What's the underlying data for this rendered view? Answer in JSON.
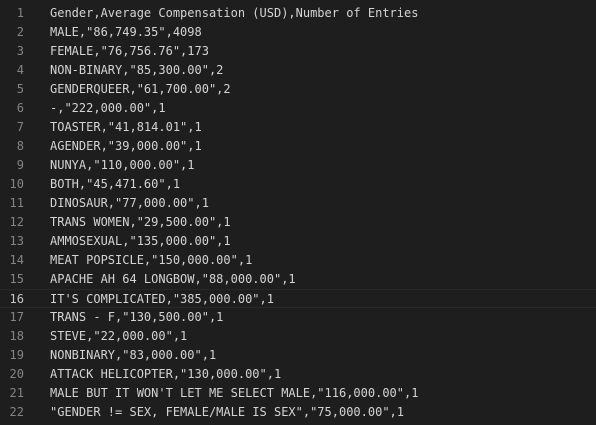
{
  "editor": {
    "current_line": 16,
    "lines": [
      {
        "num": "1",
        "text": "Gender,Average Compensation (USD),Number of Entries"
      },
      {
        "num": "2",
        "text": "MALE,\"86,749.35\",4098"
      },
      {
        "num": "3",
        "text": "FEMALE,\"76,756.76\",173"
      },
      {
        "num": "4",
        "text": "NON-BINARY,\"85,300.00\",2"
      },
      {
        "num": "5",
        "text": "GENDERQUEER,\"61,700.00\",2"
      },
      {
        "num": "6",
        "text": "-,\"222,000.00\",1"
      },
      {
        "num": "7",
        "text": "TOASTER,\"41,814.01\",1"
      },
      {
        "num": "8",
        "text": "AGENDER,\"39,000.00\",1"
      },
      {
        "num": "9",
        "text": "NUNYA,\"110,000.00\",1"
      },
      {
        "num": "10",
        "text": "BOTH,\"45,471.60\",1"
      },
      {
        "num": "11",
        "text": "DINOSAUR,\"77,000.00\",1"
      },
      {
        "num": "12",
        "text": "TRANS WOMEN,\"29,500.00\",1"
      },
      {
        "num": "13",
        "text": "AMMOSEXUAL,\"135,000.00\",1"
      },
      {
        "num": "14",
        "text": "MEAT POPSICLE,\"150,000.00\",1"
      },
      {
        "num": "15",
        "text": "APACHE AH 64 LONGBOW,\"88,000.00\",1"
      },
      {
        "num": "16",
        "text": "IT'S COMPLICATED,\"385,000.00\",1"
      },
      {
        "num": "17",
        "text": "TRANS - F,\"130,500.00\",1"
      },
      {
        "num": "18",
        "text": "STEVE,\"22,000.00\",1"
      },
      {
        "num": "19",
        "text": "NONBINARY,\"83,000.00\",1"
      },
      {
        "num": "20",
        "text": "ATTACK HELICOPTER,\"130,000.00\",1"
      },
      {
        "num": "21",
        "text": "MALE BUT IT WON'T LET ME SELECT MALE,\"116,000.00\",1"
      },
      {
        "num": "22",
        "text": "\"GENDER != SEX, FEMALE/MALE IS SEX\",\"75,000.00\",1"
      }
    ]
  },
  "colors": {
    "background": "#1e1e1e",
    "text": "#d4d4d4",
    "line_number": "#858585",
    "line_number_active": "#c6c6c6",
    "current_line_border": "#282828"
  }
}
